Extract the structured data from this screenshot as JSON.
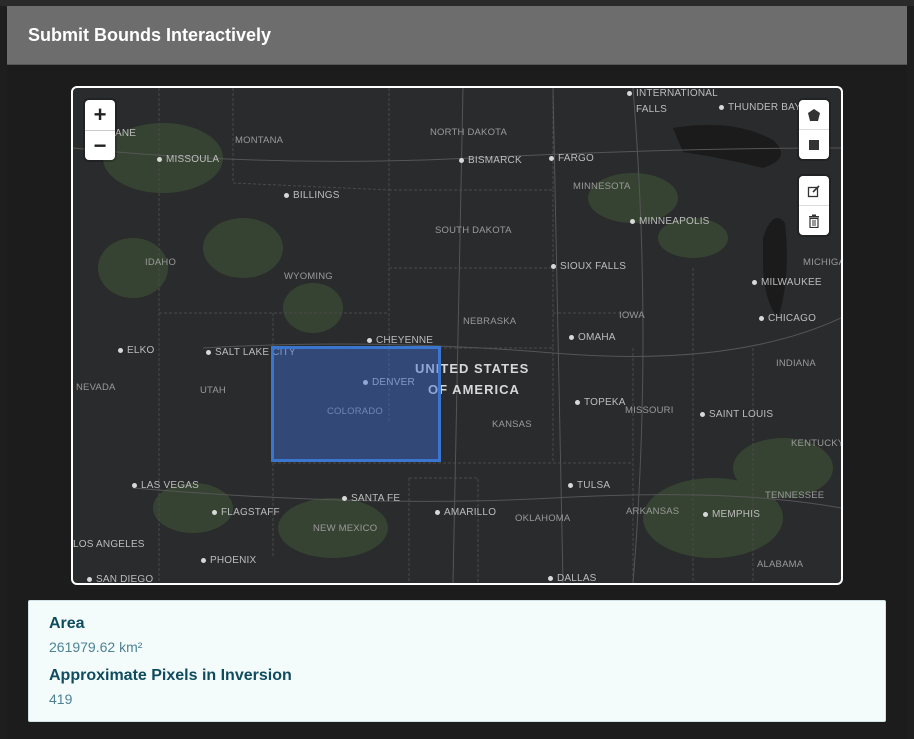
{
  "modal": {
    "title": "Submit Bounds Interactively"
  },
  "map": {
    "zoom_in": "+",
    "zoom_out": "−",
    "draw_tools": [
      "draw-polygon",
      "draw-rectangle"
    ],
    "edit_tools": [
      "edit-layers",
      "delete-layers"
    ],
    "labels": {
      "cities": [
        "INTERNATIONAL",
        "FALLS",
        "THUNDER BAY",
        "ANE",
        "MISSOULA",
        "BISMARCK",
        "FARGO",
        "BILLINGS",
        "MINNEAPOLIS",
        "SIOUX FALLS",
        "MILWAUKEE",
        "CHICAGO",
        "ELKO",
        "SALT LAKE CITY",
        "CHEYENNE",
        "OMAHA",
        "DENVER",
        "TOPEKA",
        "SAINT LOUIS",
        "LAS VEGAS",
        "SANTA FE",
        "TULSA",
        "FLAGSTAFF",
        "AMARILLO",
        "MEMPHIS",
        "PHOENIX",
        "LOS ANGELES",
        "SAN DIEGO",
        "DALLAS"
      ],
      "states": [
        "MONTANA",
        "NORTH DAKOTA",
        "MINNESOTA",
        "SOUTH DAKOTA",
        "IDAHO",
        "WYOMING",
        "MICHIGA",
        "NEBRASKA",
        "IOWA",
        "NEVADA",
        "UTAH",
        "COLORADO",
        "KANSAS",
        "MISSOURI",
        "INDIANA",
        "KENTUCKY",
        "TENNESSEE",
        "NEW MEXICO",
        "OKLAHOMA",
        "ARKANSAS",
        "ALABAMA"
      ],
      "country_line1": "UNITED STATES",
      "country_line2": "OF AMERICA"
    }
  },
  "info": {
    "area_title": "Area",
    "area_value": "261979.62 km²",
    "pixels_title": "Approximate Pixels in Inversion",
    "pixels_value": "419"
  },
  "colors": {
    "bounds_fill": "#3c6ed2",
    "bounds_stroke": "#3a75d0",
    "header": "#6d6d6d",
    "info_title": "#0f4b5e"
  }
}
